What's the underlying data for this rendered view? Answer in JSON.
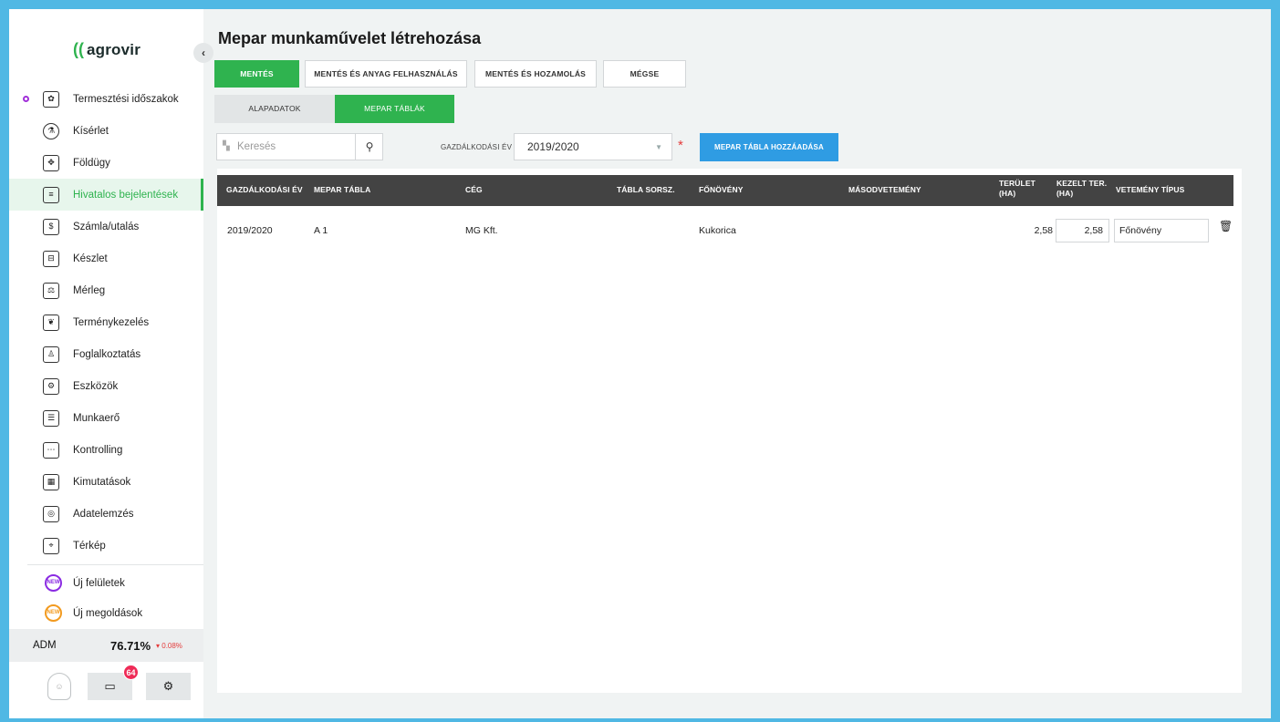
{
  "sidebar": {
    "logo_text": "agrovir",
    "collapse_glyph": "‹",
    "items": [
      {
        "label": "Termesztési időszakok",
        "icon": "seedling-calendar-icon"
      },
      {
        "label": "Kísérlet",
        "icon": "flask-icon"
      },
      {
        "label": "Földügy",
        "icon": "land-puzzle-icon"
      },
      {
        "label": "Hivatalos bejelentések",
        "icon": "document-icon"
      },
      {
        "label": "Számla/utalás",
        "icon": "invoice-icon"
      },
      {
        "label": "Készlet",
        "icon": "inventory-icon"
      },
      {
        "label": "Mérleg",
        "icon": "scale-icon"
      },
      {
        "label": "Terménykezelés",
        "icon": "crop-handling-icon"
      },
      {
        "label": "Foglalkoztatás",
        "icon": "employment-icon"
      },
      {
        "label": "Eszközök",
        "icon": "tractor-icon"
      },
      {
        "label": "Munkaerő",
        "icon": "id-card-icon"
      },
      {
        "label": "Kontrolling",
        "icon": "abacus-icon"
      },
      {
        "label": "Kimutatások",
        "icon": "report-icon"
      },
      {
        "label": "Adatelemzés",
        "icon": "analytics-icon"
      },
      {
        "label": "Térkép",
        "icon": "map-icon"
      }
    ],
    "extra_items": [
      {
        "label": "Új felületek",
        "badge": "NEW"
      },
      {
        "label": "Új megoldások",
        "badge": "NEW"
      }
    ],
    "adm": {
      "label": "ADM",
      "value": "76.71%",
      "change": "▾ 0.08%"
    },
    "message_count": "64"
  },
  "page": {
    "title": "Mepar munkaművelet létrehozása"
  },
  "actions": {
    "save": "MENTÉS",
    "save_material": "MENTÉS ÉS ANYAG FELHASZNÁLÁS",
    "save_yield": "MENTÉS ÉS HOZAMOLÁS",
    "cancel": "MÉGSE"
  },
  "tabs": {
    "basic": "ALAPADATOK",
    "mepar": "MEPAR TÁBLÁK"
  },
  "filters": {
    "search_placeholder": "Keresés",
    "year_label": "GAZDÁLKODÁSI ÉV",
    "year_value": "2019/2020",
    "required_mark": "*",
    "add_button": "MEPAR TÁBLA HOZZÁADÁSA"
  },
  "table": {
    "headers": {
      "year": "GAZDÁLKODÁSI ÉV",
      "mepar": "MEPAR TÁBLA",
      "company": "CÉG",
      "serial": "TÁBLA SORSZ.",
      "main_crop": "FŐNÖVÉNY",
      "second_crop": "MÁSODVETEMÉNY",
      "area_1": "TERÜLET",
      "area_2": "(HA)",
      "treated_1": "KEZELT TER.",
      "treated_2": "(HA)",
      "crop_type": "VETEMÉNY TÍPUS"
    },
    "rows": [
      {
        "year": "2019/2020",
        "mepar": "A 1",
        "company": "MG Kft.",
        "serial": "",
        "main_crop": "Kukorica",
        "second_crop": "",
        "area": "2,58",
        "treated": "2,58",
        "crop_type": "Főnövény"
      }
    ]
  }
}
